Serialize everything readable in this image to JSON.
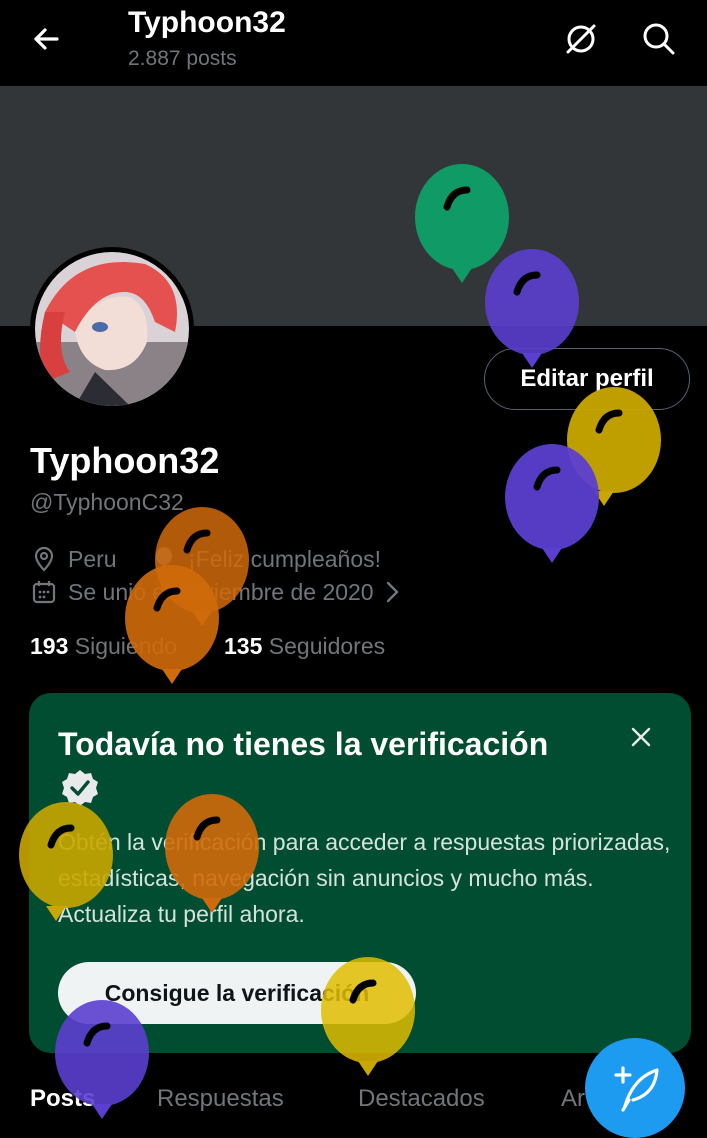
{
  "header": {
    "title": "Typhoon32",
    "posts_count": "2.887 posts"
  },
  "profile": {
    "name": "Typhoon32",
    "handle": "@TyphoonC32",
    "location": "Peru",
    "birthday": "¡Feliz cumpleaños!",
    "joined": "Se unió el noviembre de 2020",
    "following_count": "193",
    "following_label": "Siguiendo",
    "followers_count": "135",
    "followers_label": "Seguidores",
    "edit_label": "Editar perfil"
  },
  "verification_card": {
    "title": "Todavía no tienes la verificación",
    "body": "Obtén la verificación para acceder a respuestas priorizadas, estadísticas, navegación sin anuncios y mucho más. Actualiza tu perfil ahora.",
    "button": "Consigue la verificación"
  },
  "tabs": [
    "Posts",
    "Respuestas",
    "Destacados",
    "Ar"
  ],
  "colors": {
    "accent": "#1d9bf0",
    "card": "#014d31",
    "balloon_green": "#0f9a66",
    "balloon_purple": "#5b3fd0",
    "balloon_yellow": "#c9a600",
    "balloon_orange": "#d06a0a"
  },
  "icons": [
    "back-arrow-icon",
    "ai-circle-icon",
    "search-icon",
    "location-icon",
    "balloon-icon",
    "calendar-icon",
    "chevron-right-icon",
    "close-icon",
    "verified-badge-icon",
    "compose-post-icon"
  ]
}
